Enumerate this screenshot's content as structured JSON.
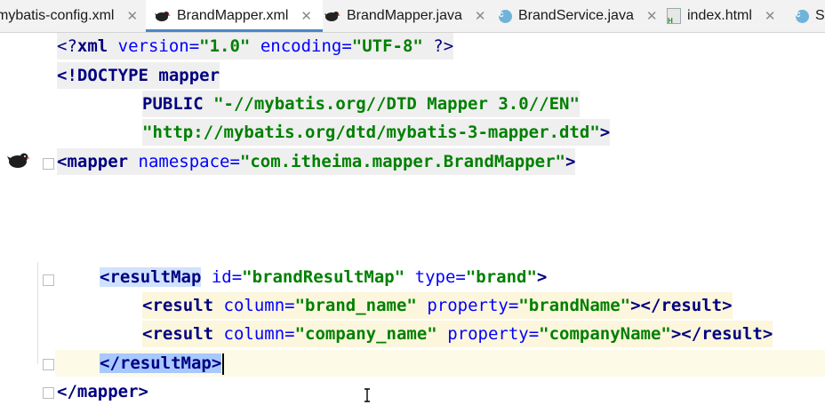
{
  "tabs": [
    {
      "label": "mybatis-config.xml",
      "icon": "xml-file-icon",
      "active": false
    },
    {
      "label": "BrandMapper.xml",
      "icon": "mybatis-bird-icon",
      "active": true
    },
    {
      "label": "BrandMapper.java",
      "icon": "mybatis-bird-icon",
      "active": false
    },
    {
      "label": "BrandService.java",
      "icon": "class-c-icon",
      "active": false
    },
    {
      "label": "index.html",
      "icon": "html-file-icon",
      "active": false
    },
    {
      "label": "Se",
      "icon": "class-c-icon",
      "active": false
    }
  ],
  "close_glyph": "✕",
  "code": {
    "l1": {
      "open": "<?",
      "tag": "xml",
      "a1": " version=",
      "v1": "\"1.0\"",
      "a2": " encoding=",
      "v2": "\"UTF-8\"",
      "close": " ?>"
    },
    "l2": {
      "open": "<!DOCTYPE",
      "name": " mapper"
    },
    "l3": {
      "kw": "PUBLIC",
      "str": " \"-//mybatis.org//DTD Mapper 3.0//EN\""
    },
    "l4": {
      "str": "\"http://mybatis.org/dtd/mybatis-3-mapper.dtd\"",
      "close": ">"
    },
    "l5": {
      "open": "<mapper",
      "attr": " namespace=",
      "val": "\"com.itheima.mapper.BrandMapper\"",
      "close": ">"
    },
    "l6": {
      "open": "<resultMap",
      "a1": " id=",
      "v1": "\"brandResultMap\"",
      "a2": " type=",
      "v2": "\"brand\"",
      "close": ">"
    },
    "l7": {
      "open": "<result",
      "a1": " column=",
      "v1": "\"brand_name\"",
      "a2": " property=",
      "v2": "\"brandName\"",
      "mid": "></",
      "tag": "result",
      "close": ">"
    },
    "l8": {
      "open": "<result",
      "a1": " column=",
      "v1": "\"company_name\"",
      "a2": " property=",
      "v2": "\"companyName\"",
      "mid": "></",
      "tag": "result",
      "close": ">"
    },
    "l9": {
      "text": "</resultMap>"
    },
    "l10": {
      "text": "</mapper>"
    }
  }
}
